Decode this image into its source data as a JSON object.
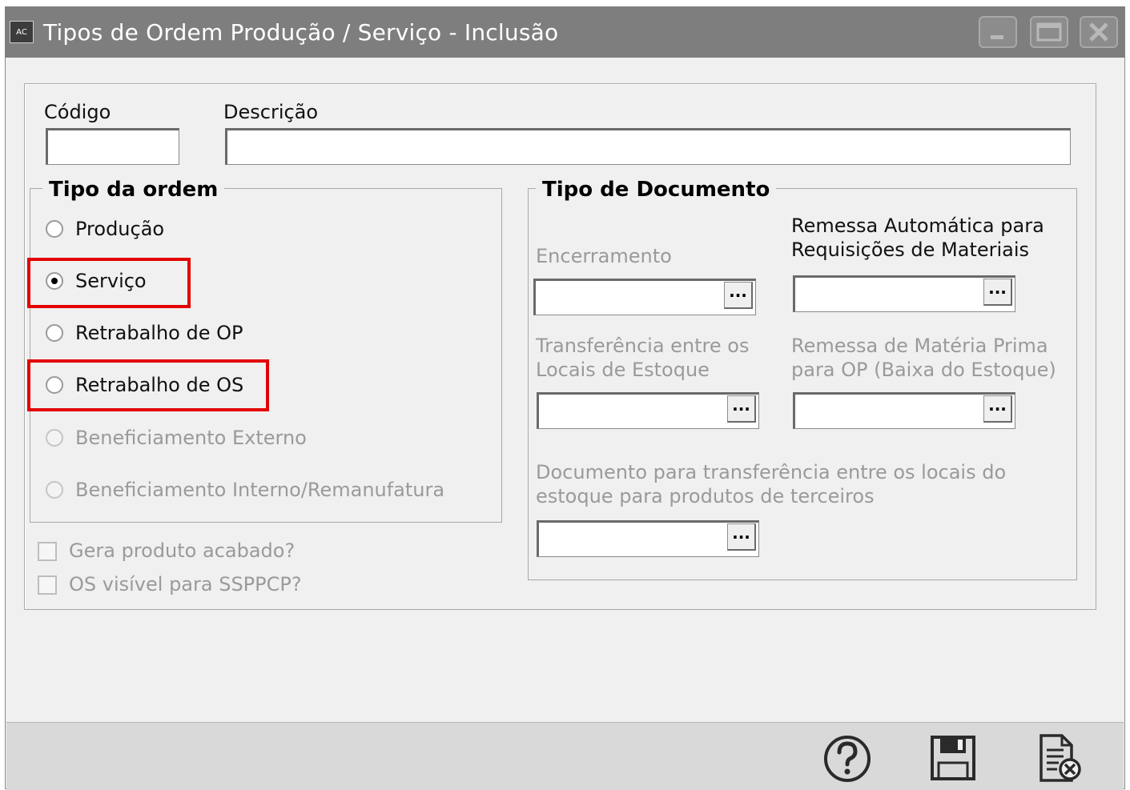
{
  "window": {
    "app_icon_text": "AC",
    "title": "Tipos de Ordem Produção / Serviço - Inclusão"
  },
  "form": {
    "codigo_label": "Código",
    "codigo_value": "",
    "descricao_label": "Descrição",
    "descricao_value": ""
  },
  "tipo_ordem": {
    "legend": "Tipo da ordem",
    "options": [
      {
        "label": "Produção",
        "selected": false,
        "enabled": true
      },
      {
        "label": "Serviço",
        "selected": true,
        "enabled": true
      },
      {
        "label": "Retrabalho de OP",
        "selected": false,
        "enabled": true
      },
      {
        "label": "Retrabalho de OS",
        "selected": false,
        "enabled": true
      },
      {
        "label": "Beneficiamento Externo",
        "selected": false,
        "enabled": false
      },
      {
        "label": "Beneficiamento Interno/Remanufatura",
        "selected": false,
        "enabled": false
      }
    ]
  },
  "checkboxes": [
    {
      "label": "Gera produto acabado?",
      "checked": false,
      "enabled": false
    },
    {
      "label": "OS visível para SSPPCP?",
      "checked": false,
      "enabled": false
    }
  ],
  "tipo_documento": {
    "legend": "Tipo de Documento",
    "encerramento_label": "Encerramento",
    "remessa_auto_label_1": "Remessa Automática para",
    "remessa_auto_label_2": "Requisições de Materiais",
    "transferencia_label_1": "Transferência entre os",
    "transferencia_label_2": "Locais de Estoque",
    "remessa_mp_label_1": "Remessa de Matéria Prima",
    "remessa_mp_label_2": "para OP (Baixa do Estoque)",
    "doc_terceiros_label_1": "Documento para transferência entre os locais do",
    "doc_terceiros_label_2": "estoque para produtos de terceiros",
    "ellipsis": "..."
  },
  "colors": {
    "titlebar": "#7e7e7e",
    "highlight": "#e30000",
    "disabled_text": "#9a9a9a"
  },
  "icons": [
    "minimize-icon",
    "maximize-icon",
    "close-icon",
    "help-icon",
    "save-icon",
    "cancel-document-icon"
  ]
}
